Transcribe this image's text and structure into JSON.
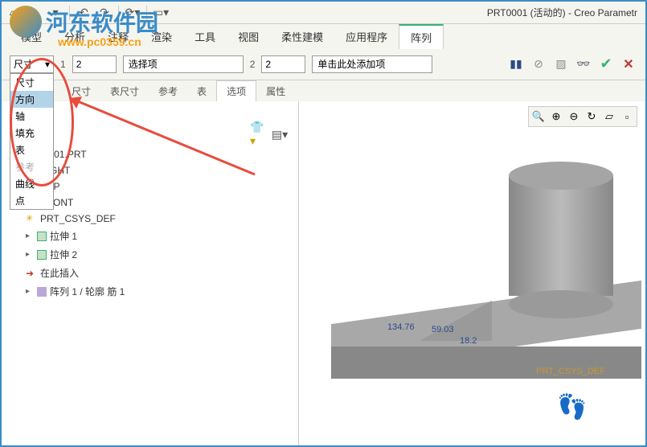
{
  "watermark": {
    "text": "河东软件园",
    "url": "www.pc0359.cn"
  },
  "window_title": "PRT0001 (活动的) - Creo Parametr",
  "menu": {
    "items": [
      "模型",
      "分析",
      "注释",
      "渲染",
      "工具",
      "视图",
      "柔性建模",
      "应用程序",
      "阵列"
    ],
    "active_index": 8
  },
  "dim_dropdown": {
    "current": "尺寸",
    "options": [
      "尺寸",
      "方向",
      "轴",
      "填充",
      "表",
      "参考",
      "曲线",
      "点"
    ],
    "highlighted_index": 1,
    "disabled_index": 5
  },
  "ribbon": {
    "num1_label": "1",
    "num1_value": "2",
    "select1": "选择项",
    "num2_label": "2",
    "num2_value": "2",
    "select2": "单击此处添加项"
  },
  "tabs": {
    "items": [
      "尺寸",
      "表尺寸",
      "参考",
      "表",
      "选项",
      "属性"
    ],
    "active_index": 4
  },
  "tree": {
    "root": "PRT0001.PRT",
    "nodes": [
      {
        "icon": "plane",
        "label": "RIGHT"
      },
      {
        "icon": "plane",
        "label": "TOP"
      },
      {
        "icon": "plane",
        "label": "FRONT"
      },
      {
        "icon": "csys",
        "label": "PRT_CSYS_DEF"
      },
      {
        "icon": "extrude",
        "label": "拉伸 1",
        "expand": true
      },
      {
        "icon": "extrude",
        "label": "拉伸 2",
        "expand": true
      },
      {
        "icon": "arrow",
        "label": "在此插入"
      },
      {
        "icon": "pattern",
        "label": "阵列 1 / 轮廓 筋 1",
        "expand": true
      }
    ]
  },
  "viewport": {
    "dims": {
      "d1": "134.76",
      "d2": "59.03",
      "d3": "18.2"
    },
    "csys_label": "PRT_CSYS_DEF"
  }
}
